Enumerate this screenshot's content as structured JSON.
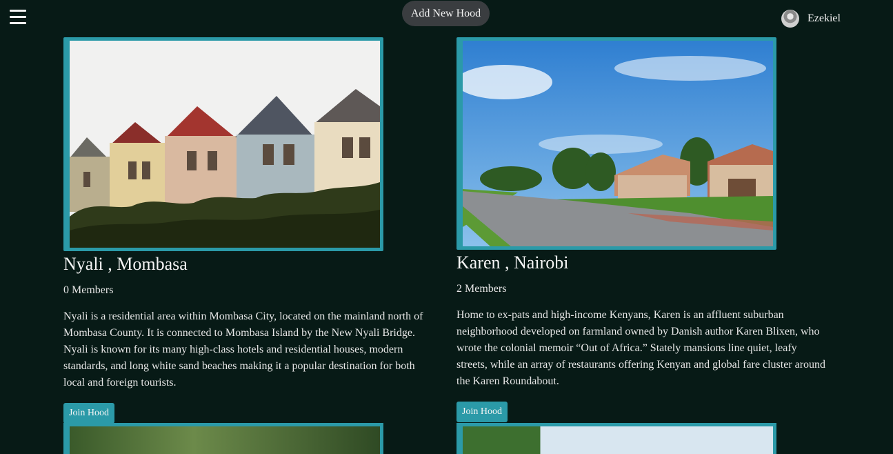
{
  "header": {
    "menu_icon": "hamburger-icon",
    "add_button_label": "Add New Hood",
    "user": {
      "name": "Ezekiel",
      "avatar_icon": "avatar"
    }
  },
  "colors": {
    "background": "#071a16",
    "accent": "#2b9aa8",
    "add_button_bg": "#3a3d40"
  },
  "hoods": [
    {
      "title": "Nyali , Mombasa",
      "members": "0 Members",
      "description": "Nyali is a residential area within Mombasa City, located on the mainland north of Mombasa County. It is connected to Mombasa Island by the New Nyali Bridge. Nyali is known for its many high-class hotels and residential houses, modern standards, and long white sand beaches making it a popular destination for both local and foreign tourists.",
      "join_label": "Join Hood"
    },
    {
      "title": "Karen , Nairobi",
      "members": "2 Members",
      "description": "Home to ex-pats and high-income Kenyans, Karen is an affluent suburban neighborhood developed on farmland owned by Danish author Karen Blixen, who wrote the colonial memoir “Out of Africa.” Stately mansions line quiet, leafy streets, while an array of restaurants offering Kenyan and global fare cluster around the Karen Roundabout.",
      "join_label": "Join Hood"
    }
  ]
}
